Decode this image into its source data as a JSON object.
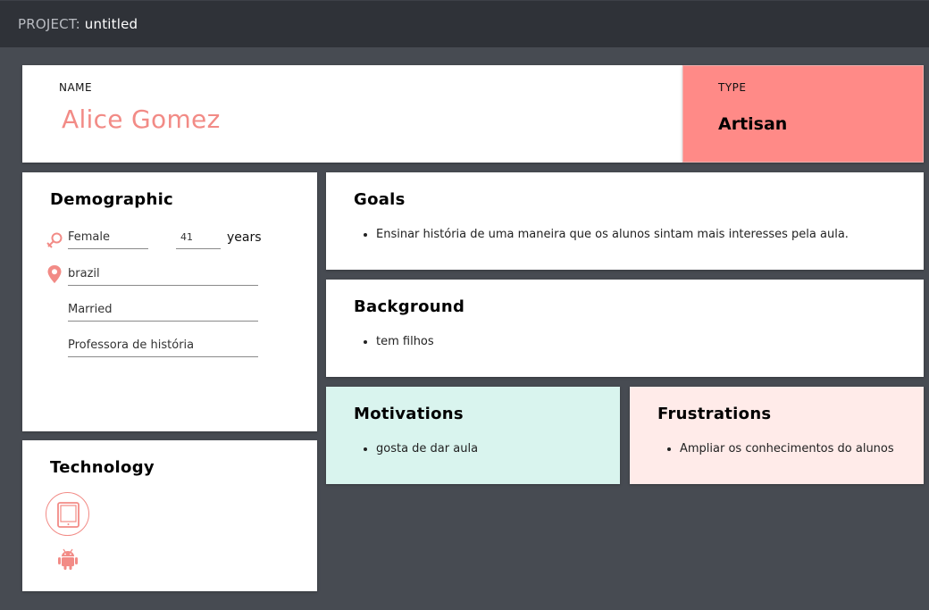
{
  "header": {
    "project_label": "PROJECT:",
    "project_name": "untitled"
  },
  "persona": {
    "name_label": "NAME",
    "name": "Alice Gomez",
    "type_label": "TYPE",
    "type": "Artisan"
  },
  "demographic": {
    "title": "Demographic",
    "gender": "Female",
    "age": "41",
    "age_unit": "years",
    "country": "brazil",
    "marital_status": "Married",
    "occupation": "Professora de história",
    "icons": [
      "gender-icon",
      "location-pin-icon"
    ]
  },
  "technology": {
    "title": "Technology",
    "icons": [
      "tablet-icon",
      "android-icon"
    ]
  },
  "goals": {
    "title": "Goals",
    "items": [
      "Ensinar história de uma maneira que os alunos sintam mais interesses pela aula."
    ]
  },
  "background": {
    "title": "Background",
    "items": [
      "tem filhos"
    ]
  },
  "motivations": {
    "title": "Motivations",
    "items": [
      "gosta de dar aula"
    ]
  },
  "frustrations": {
    "title": "Frustrations",
    "items": [
      "Ampliar os conhecimentos do alunos"
    ]
  },
  "colors": {
    "background": "#474b52",
    "topbar": "#2f3238",
    "accent": "#f28b86",
    "type_card": "#ff8a87",
    "motivations_card": "#d9f4ee",
    "frustrations_card": "#ffebe9"
  }
}
